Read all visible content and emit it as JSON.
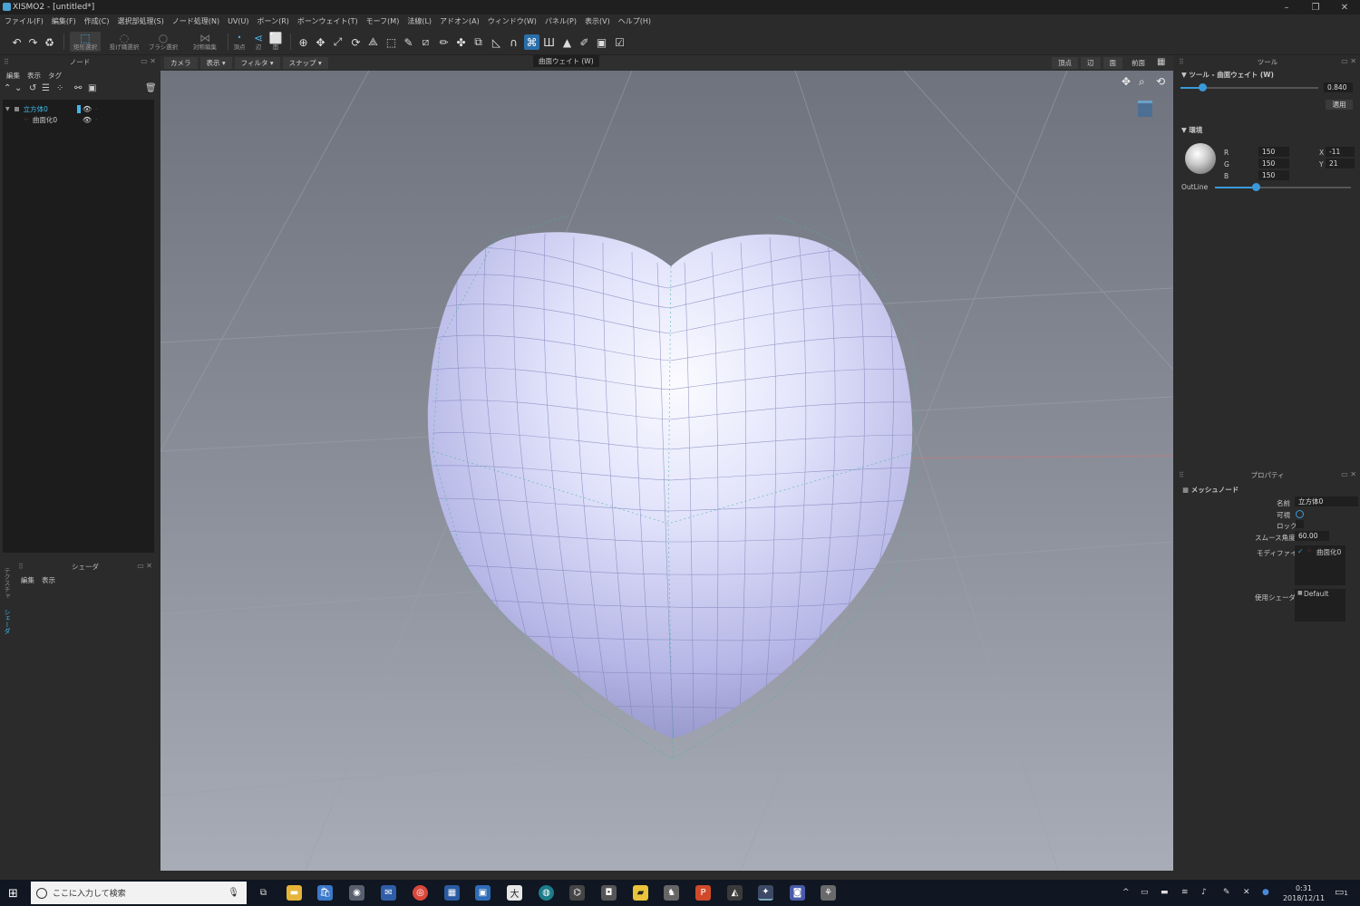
{
  "window": {
    "title": "XISMO2 - [untitled*]",
    "min": "–",
    "restore": "❐",
    "close": "✕"
  },
  "menu": [
    "ファイル(F)",
    "編集(F)",
    "作成(C)",
    "選択部処理(S)",
    "ノード処理(N)",
    "UV(U)",
    "ボーン(R)",
    "ボーンウェイト(T)",
    "モーフ(M)",
    "法線(L)",
    "アドオン(A)",
    "ウィンドウ(W)",
    "パネル(P)",
    "表示(V)",
    "ヘルプ(H)"
  ],
  "toolbar": {
    "rect_select": "矩形選択",
    "lasso_select": "投げ縄選択",
    "brush_select": "ブラシ選択",
    "sym_edit": "対称編集",
    "vertex": "頂点",
    "edge": "辺",
    "face": "面",
    "tooltip": "曲面ウェイト (W)"
  },
  "left_panel": {
    "node_title": "ノード",
    "tabs": [
      "編集",
      "表示",
      "タグ"
    ],
    "tree": [
      {
        "label": "立方体0",
        "color": "#3fb8e8"
      },
      {
        "label": "曲面化0",
        "color": "#c8c8c8"
      }
    ],
    "shader_title": "シェーダ",
    "shader_tabs": [
      "編集",
      "表示"
    ],
    "vtabs": [
      "テクスチャ",
      "シェーダ"
    ]
  },
  "viewport": {
    "left_buttons": [
      "カメラ",
      "表示 ▾",
      "フィルタ ▾",
      "スナップ ▾"
    ],
    "right_buttons": [
      "頂点",
      "辺",
      "面",
      "前面"
    ]
  },
  "right_panel": {
    "tool_title": "ツール",
    "tool_header": "ツール - 曲面ウェイト (W)",
    "weight_value": "0.840",
    "weight_level": 0.84,
    "apply": "適用",
    "env_header": "環境",
    "rgb": [
      {
        "label": "R",
        "value": "150"
      },
      {
        "label": "G",
        "value": "150"
      },
      {
        "label": "B",
        "value": "150"
      }
    ],
    "xy": [
      {
        "label": "X",
        "value": "-11"
      },
      {
        "label": "Y",
        "value": "21"
      }
    ],
    "outline_label": "OutLine",
    "outline_level": 0.3,
    "prop_title": "プロパティ",
    "prop_header": "メッシュノード",
    "props": {
      "name_label": "名前",
      "name_value": "立方体0",
      "visible_label": "可視",
      "lock_label": "ロック",
      "smooth_label": "スムース角度",
      "smooth_value": "60.00",
      "modifier_label": "モディファイア",
      "modifier_value": "曲面化0",
      "shader_label": "使用シェーダ",
      "shader_value": "Default"
    }
  },
  "taskbar": {
    "search_placeholder": "ここに入力して検索",
    "time": "0:31",
    "date": "2018/12/11",
    "notif": "1"
  },
  "colors": {
    "accent": "#3a9ad9",
    "heart": "#cfd0f5",
    "selected_tree": "#3fb8e8"
  }
}
